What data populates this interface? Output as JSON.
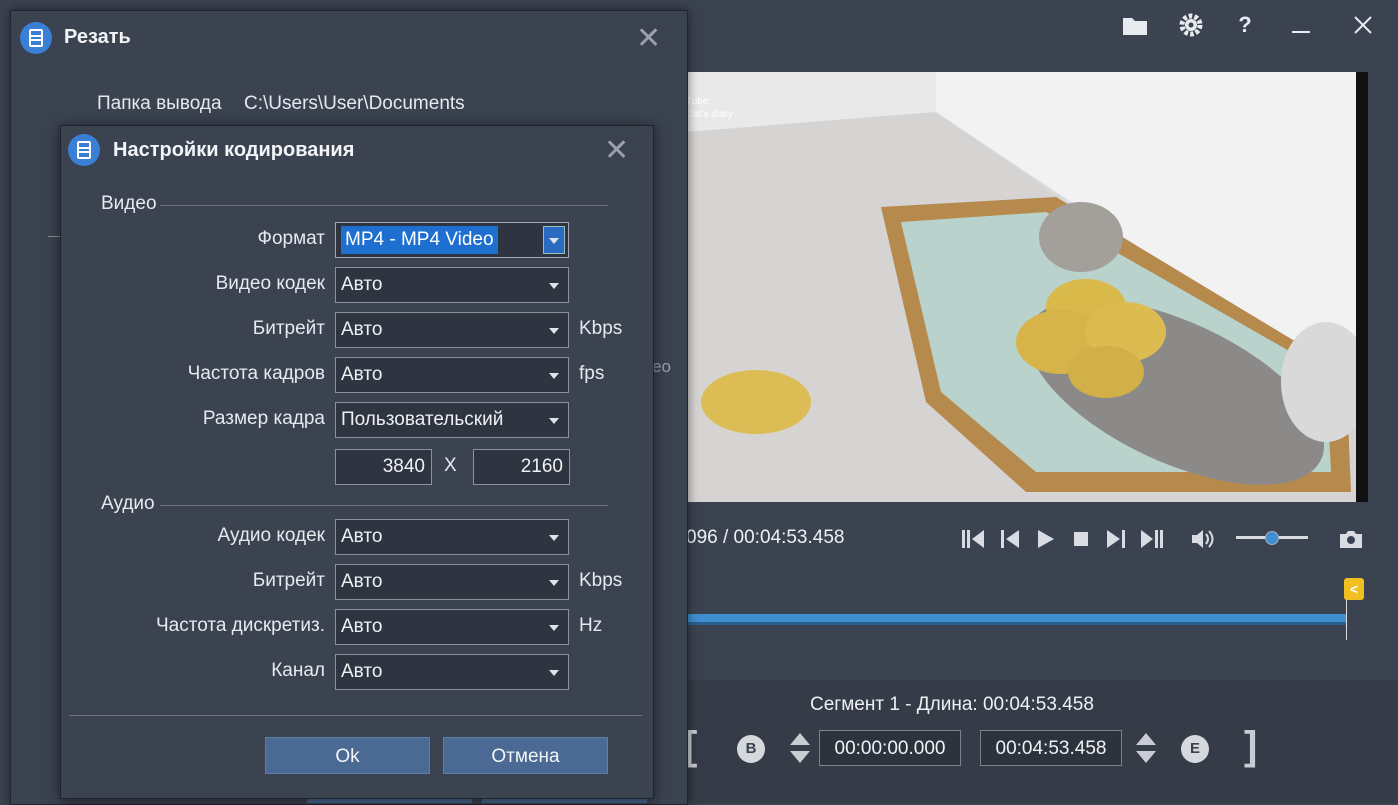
{
  "main": {
    "time_readout": "096 / 00:04:53.458",
    "video_watermark_1": "Tube",
    "video_watermark_2": "Cat's diary",
    "segment_label": "Сегмент 1 - Длина: 00:04:53.458",
    "start_time": "00:00:00.000",
    "end_time": "00:04:53.458",
    "begin_marker": "B",
    "end_marker": "E",
    "marker_glyph": "<",
    "icons": [
      "folder-icon",
      "gear-icon",
      "help-icon",
      "minimize-icon",
      "close-icon"
    ],
    "volume_level": 0.5,
    "accent": "#3f8fd0"
  },
  "cut_window": {
    "title": "Резать",
    "output_folder_label": "Папка вывода",
    "output_folder_value": "C:\\Users\\User\\Documents",
    "partial_text": "ео"
  },
  "encoding": {
    "title": "Настройки кодирования",
    "video_section": "Видео",
    "audio_section": "Аудио",
    "format_label": "Формат",
    "format_value": "MP4 - MP4 Video",
    "video_codec_label": "Видео кодек",
    "video_codec_value": "Авто",
    "video_bitrate_label": "Битрейт",
    "video_bitrate_value": "Авто",
    "video_bitrate_unit": "Kbps",
    "framerate_label": "Частота кадров",
    "framerate_value": "Авто",
    "framerate_unit": "fps",
    "framesize_label": "Размер кадра",
    "framesize_value": "Пользовательский",
    "width_value": "3840",
    "size_separator": "X",
    "height_value": "2160",
    "audio_codec_label": "Аудио кодек",
    "audio_codec_value": "Авто",
    "audio_bitrate_label": "Битрейт",
    "audio_bitrate_value": "Авто",
    "audio_bitrate_unit": "Kbps",
    "samplerate_label": "Частота дискретиз.",
    "samplerate_value": "Авто",
    "samplerate_unit": "Hz",
    "channel_label": "Канал",
    "channel_value": "Авто",
    "ok_label": "Ok",
    "cancel_label": "Отмена"
  }
}
